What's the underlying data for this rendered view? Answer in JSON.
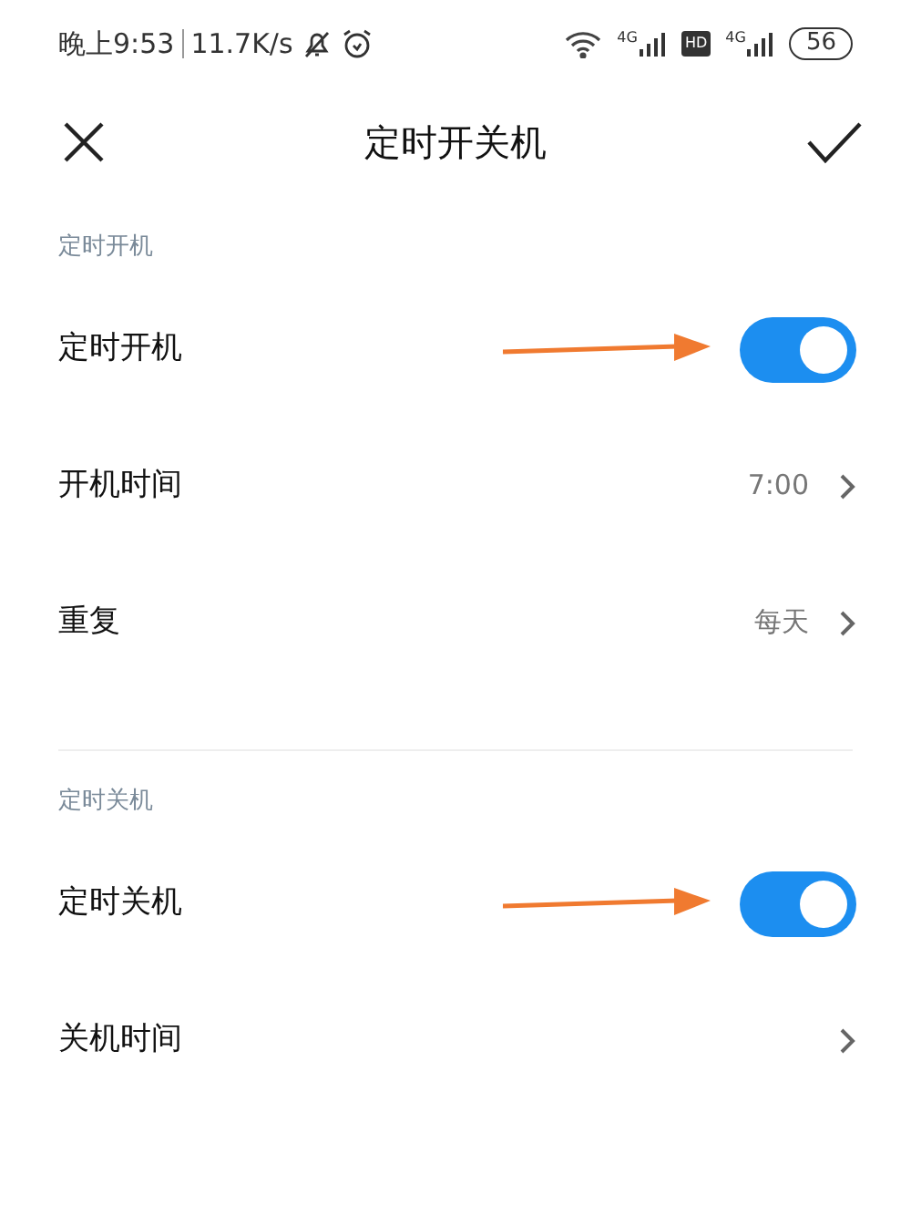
{
  "status_bar": {
    "time": "晚上9:53",
    "speed": "11.7K/s",
    "network_1": "4G",
    "hd": "HD",
    "network_2": "4G",
    "battery": "56"
  },
  "header": {
    "title": "定时开关机"
  },
  "sections": [
    {
      "label": "定时开机",
      "rows": [
        {
          "kind": "toggle",
          "label": "定时开机",
          "on": true,
          "arrow": true
        },
        {
          "kind": "value",
          "label": "开机时间",
          "value": "7:00"
        },
        {
          "kind": "value",
          "label": "重复",
          "value": "每天"
        }
      ]
    },
    {
      "label": "定时关机",
      "rows": [
        {
          "kind": "toggle",
          "label": "定时关机",
          "on": true,
          "arrow": true
        },
        {
          "kind": "value",
          "label": "关机时间"
        }
      ]
    }
  ]
}
